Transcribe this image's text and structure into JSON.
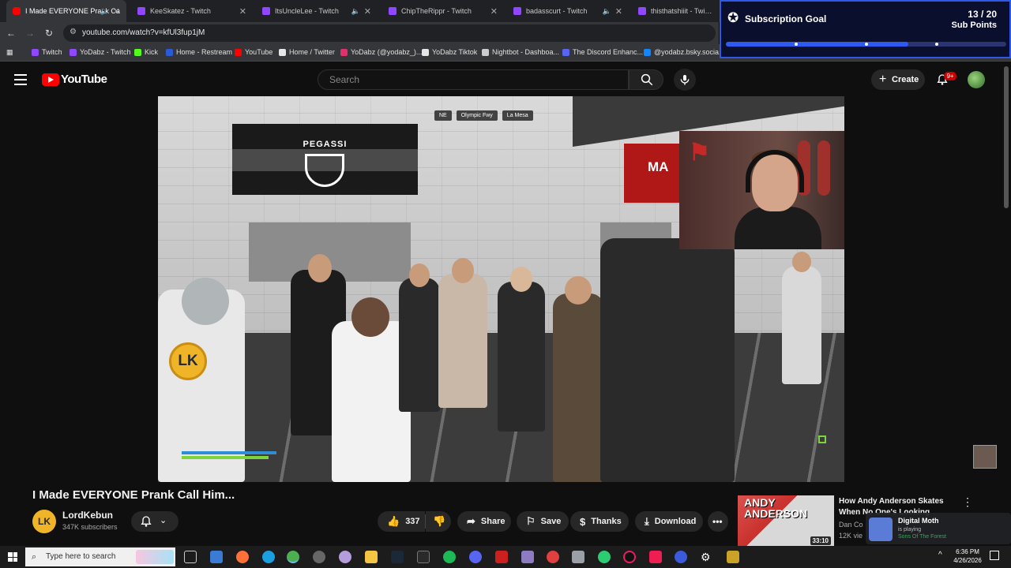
{
  "browser": {
    "tabs": [
      {
        "label": "I Made EVERYONE Prank Ca",
        "favicon": "youtube-icon",
        "muted_icon": true,
        "active": true
      },
      {
        "label": "KeeSkatez - Twitch",
        "favicon": "twitch-icon",
        "muted_icon": false,
        "active": false
      },
      {
        "label": "ItsUncleLee - Twitch",
        "favicon": "twitch-icon",
        "muted_icon": true,
        "active": false
      },
      {
        "label": "ChipTheRippr - Twitch",
        "favicon": "twitch-icon",
        "muted_icon": false,
        "active": false
      },
      {
        "label": "badasscurt - Twitch",
        "favicon": "twitch-icon",
        "muted_icon": true,
        "active": false
      },
      {
        "label": "thisthatshiiit - Twitch",
        "favicon": "twitch-icon",
        "muted_icon": false,
        "active": false
      }
    ],
    "url": "youtube.com/watch?v=kfUl3fup1jM",
    "bookmarks": [
      {
        "label": "Twitch",
        "color": "#9146ff"
      },
      {
        "label": "YoDabz - Twitch",
        "color": "#9146ff"
      },
      {
        "label": "Kick",
        "color": "#53fc18"
      },
      {
        "label": "Home - Restream",
        "color": "#2a5bd7"
      },
      {
        "label": "YouTube",
        "color": "#ff0000"
      },
      {
        "label": "Home / Twitter",
        "color": "#e6e6e6"
      },
      {
        "label": "YoDabz (@yodabz_)...",
        "color": "#e1306c"
      },
      {
        "label": "YoDabz Tiktok",
        "color": "#e6e6e6"
      },
      {
        "label": "Nightbot - Dashboa...",
        "color": "#cccccc"
      },
      {
        "label": "The Discord Enhanc...",
        "color": "#5865f2"
      },
      {
        "label": "@yodabz.bsky.socia...",
        "color": "#1185fe"
      }
    ]
  },
  "subscription_goal": {
    "title": "Subscription Goal",
    "count": "13 / 20",
    "unit": "Sub Points",
    "progress": 0.65,
    "accent_color": "#2f5af0"
  },
  "youtube": {
    "logo_text": "YouTube",
    "search_placeholder": "Search",
    "create_label": "Create",
    "notification_badge": "9+"
  },
  "video": {
    "hud_chips": [
      "NE",
      "Olympic Fwy",
      "La Mesa"
    ],
    "banner_text": "PEGASSI",
    "red_banner_text": "MA",
    "overlay_logo_text": "LK",
    "title": "I Made EVERYONE Prank Call Him...",
    "channel_name": "LordKebun",
    "channel_avatar_text": "LK",
    "subscribers": "347K subscribers",
    "likes": "337",
    "share_label": "Share",
    "save_label": "Save",
    "thanks_label": "Thanks",
    "download_label": "Download"
  },
  "recommended": {
    "thumb_text": "ANDY ANDERSON",
    "duration": "33:10",
    "title": "How Andy Anderson Skates When No One's Looking",
    "channel": "Dan Co",
    "views": "12K vie"
  },
  "discord_toast": {
    "name": "Digital Moth",
    "status": "is playing",
    "game": "Sons Of The Forest"
  },
  "taskbar": {
    "search_placeholder": "Type here to search",
    "time": "6:36 PM",
    "date": "4/26/2026"
  }
}
